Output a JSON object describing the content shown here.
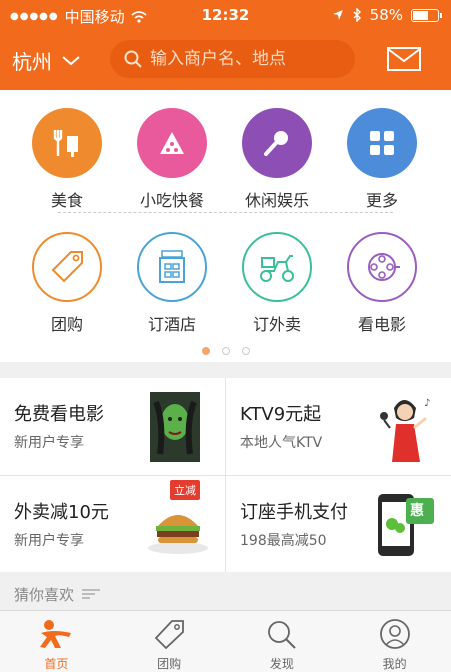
{
  "status_bar": {
    "carrier": "中国移动",
    "time": "12:32",
    "battery": "58%",
    "battery_level": 0.58
  },
  "header": {
    "city": "杭州",
    "search_placeholder": "输入商户名、地点"
  },
  "categories_row1": [
    {
      "label": "美食",
      "icon": "food-icon",
      "color": "#f08a2e"
    },
    {
      "label": "小吃快餐",
      "icon": "pizza-icon",
      "color": "#e85a9b"
    },
    {
      "label": "休闲娱乐",
      "icon": "microphone-icon",
      "color": "#8e4fb5"
    },
    {
      "label": "更多",
      "icon": "grid-icon",
      "color": "#4d8cd8"
    }
  ],
  "categories_row2": [
    {
      "label": "团购",
      "icon": "tag-icon",
      "color": "#f08a2e"
    },
    {
      "label": "订酒店",
      "icon": "hotel-icon",
      "color": "#4aa3d8"
    },
    {
      "label": "订外卖",
      "icon": "scooter-icon",
      "color": "#3bbf9a"
    },
    {
      "label": "看电影",
      "icon": "film-reel-icon",
      "color": "#9a5ec0"
    }
  ],
  "promos": [
    {
      "title": "免费看电影",
      "subtitle": "新用户专享",
      "image": "movie-poster-image"
    },
    {
      "title": "KTV9元起",
      "subtitle": "本地人气KTV",
      "image": "singer-image"
    },
    {
      "title": "外卖减10元",
      "subtitle": "新用户专享",
      "image": "burger-image",
      "badge": "立减"
    },
    {
      "title": "订座手机支付",
      "subtitle": "198最高减50",
      "image": "phone-pay-image",
      "badge": "惠"
    }
  ],
  "guess": {
    "label": "猜你喜欢"
  },
  "tabs": [
    {
      "label": "首页",
      "icon": "home-person-icon",
      "active": true
    },
    {
      "label": "团购",
      "icon": "tag-icon",
      "active": false
    },
    {
      "label": "发现",
      "icon": "search-icon",
      "active": false
    },
    {
      "label": "我的",
      "icon": "user-icon",
      "active": false
    }
  ]
}
